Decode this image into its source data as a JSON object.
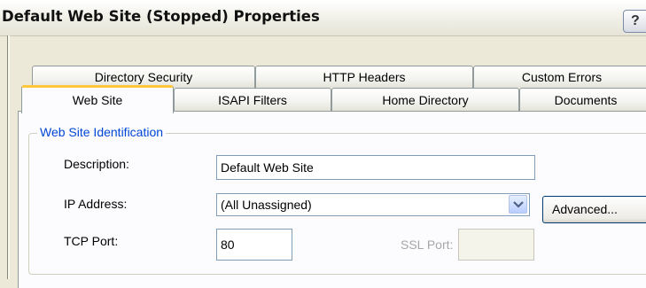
{
  "window": {
    "title": "Default Web Site (Stopped) Properties",
    "help_button": "?"
  },
  "tabs": {
    "row1": [
      "Directory Security",
      "HTTP Headers",
      "Custom Errors"
    ],
    "row2": [
      "Web Site",
      "ISAPI Filters",
      "Home Directory",
      "Documents"
    ],
    "active": "Web Site"
  },
  "group": {
    "legend": "Web Site Identification",
    "description_label": "Description:",
    "description_value": "Default Web Site",
    "ip_label": "IP Address:",
    "ip_value": "(All Unassigned)",
    "advanced_button": "Advanced...",
    "tcp_label": "TCP Port:",
    "tcp_value": "80",
    "ssl_label": "SSL Port:",
    "ssl_value": ""
  },
  "colors": {
    "accent_tab": "#ffc83c",
    "legend": "#0046d5",
    "dialog_bg": "#ece9d8"
  }
}
